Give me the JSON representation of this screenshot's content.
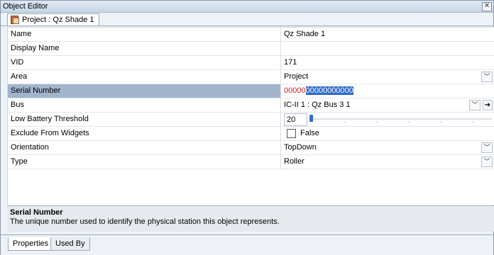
{
  "window": {
    "title": "Object Editor",
    "close_icon": "close-icon"
  },
  "tab": {
    "label": "Project : Qz Shade 1",
    "icon": "project-icon"
  },
  "properties": [
    {
      "name": "Name",
      "value": "Qz Shade 1"
    },
    {
      "name": "Display Name",
      "value": ""
    },
    {
      "name": "VID",
      "value": "171"
    },
    {
      "name": "Area",
      "value": "Project"
    },
    {
      "name": "Serial Number",
      "value_red": "00000",
      "value_selected": "00000000000"
    },
    {
      "name": "Bus",
      "value": "IC-II 1 : Qz Bus 3 1"
    },
    {
      "name": "Low Battery Threshold",
      "value": "20",
      "slider_fraction": 0.0
    },
    {
      "name": "Exclude From Widgets",
      "value": "False",
      "checked": false
    },
    {
      "name": "Orientation",
      "value": "TopDown"
    },
    {
      "name": "Type",
      "value": "Roller"
    }
  ],
  "description": {
    "title": "Serial Number",
    "text": "The unique number used to identify the physical station this object represents."
  },
  "bottom_tabs": [
    {
      "label": "Properties",
      "active": true
    },
    {
      "label": "Used By",
      "active": false
    }
  ],
  "colors": {
    "selection": "#a1b4cc",
    "serial_red": "#d21b1b",
    "highlight": "#2f69c9"
  }
}
